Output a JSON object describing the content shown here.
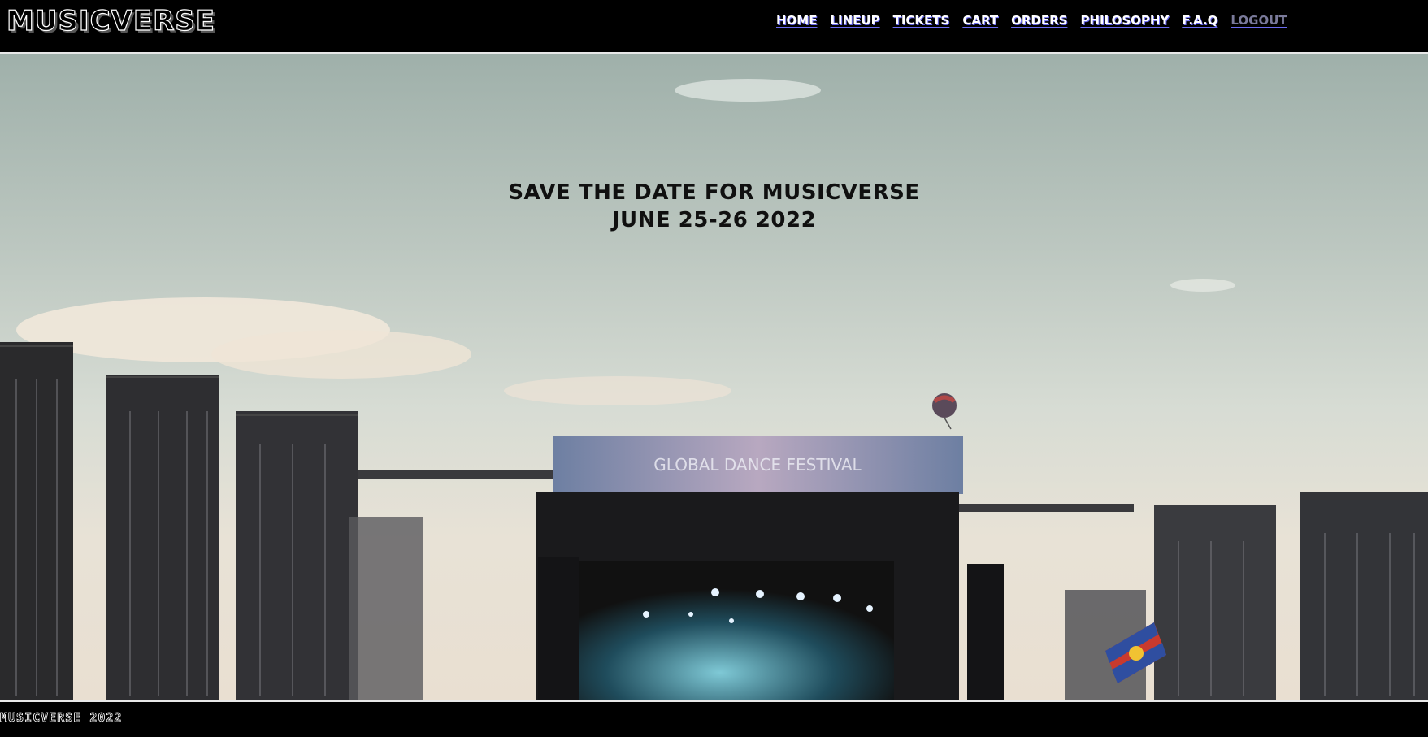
{
  "header": {
    "logo": "MUSICVERSE",
    "nav": [
      {
        "label": "HOME"
      },
      {
        "label": "LINEUP"
      },
      {
        "label": "TICKETS"
      },
      {
        "label": "CART"
      },
      {
        "label": "ORDERS"
      },
      {
        "label": "PHILOSOPHY"
      },
      {
        "label": "F.A.Q"
      },
      {
        "label": "LOGOUT"
      }
    ]
  },
  "hero": {
    "line1": "SAVE THE DATE FOR MUSICVERSE",
    "line2": "JUNE 25-26 2022",
    "banner_text": "GLOBAL DANCE FESTIVAL"
  },
  "footer": {
    "text": "MUSICVERSE 2022"
  },
  "colors": {
    "background": "#000000",
    "nav_underline": "#6a6af0",
    "logout": "#7a7a9a"
  }
}
